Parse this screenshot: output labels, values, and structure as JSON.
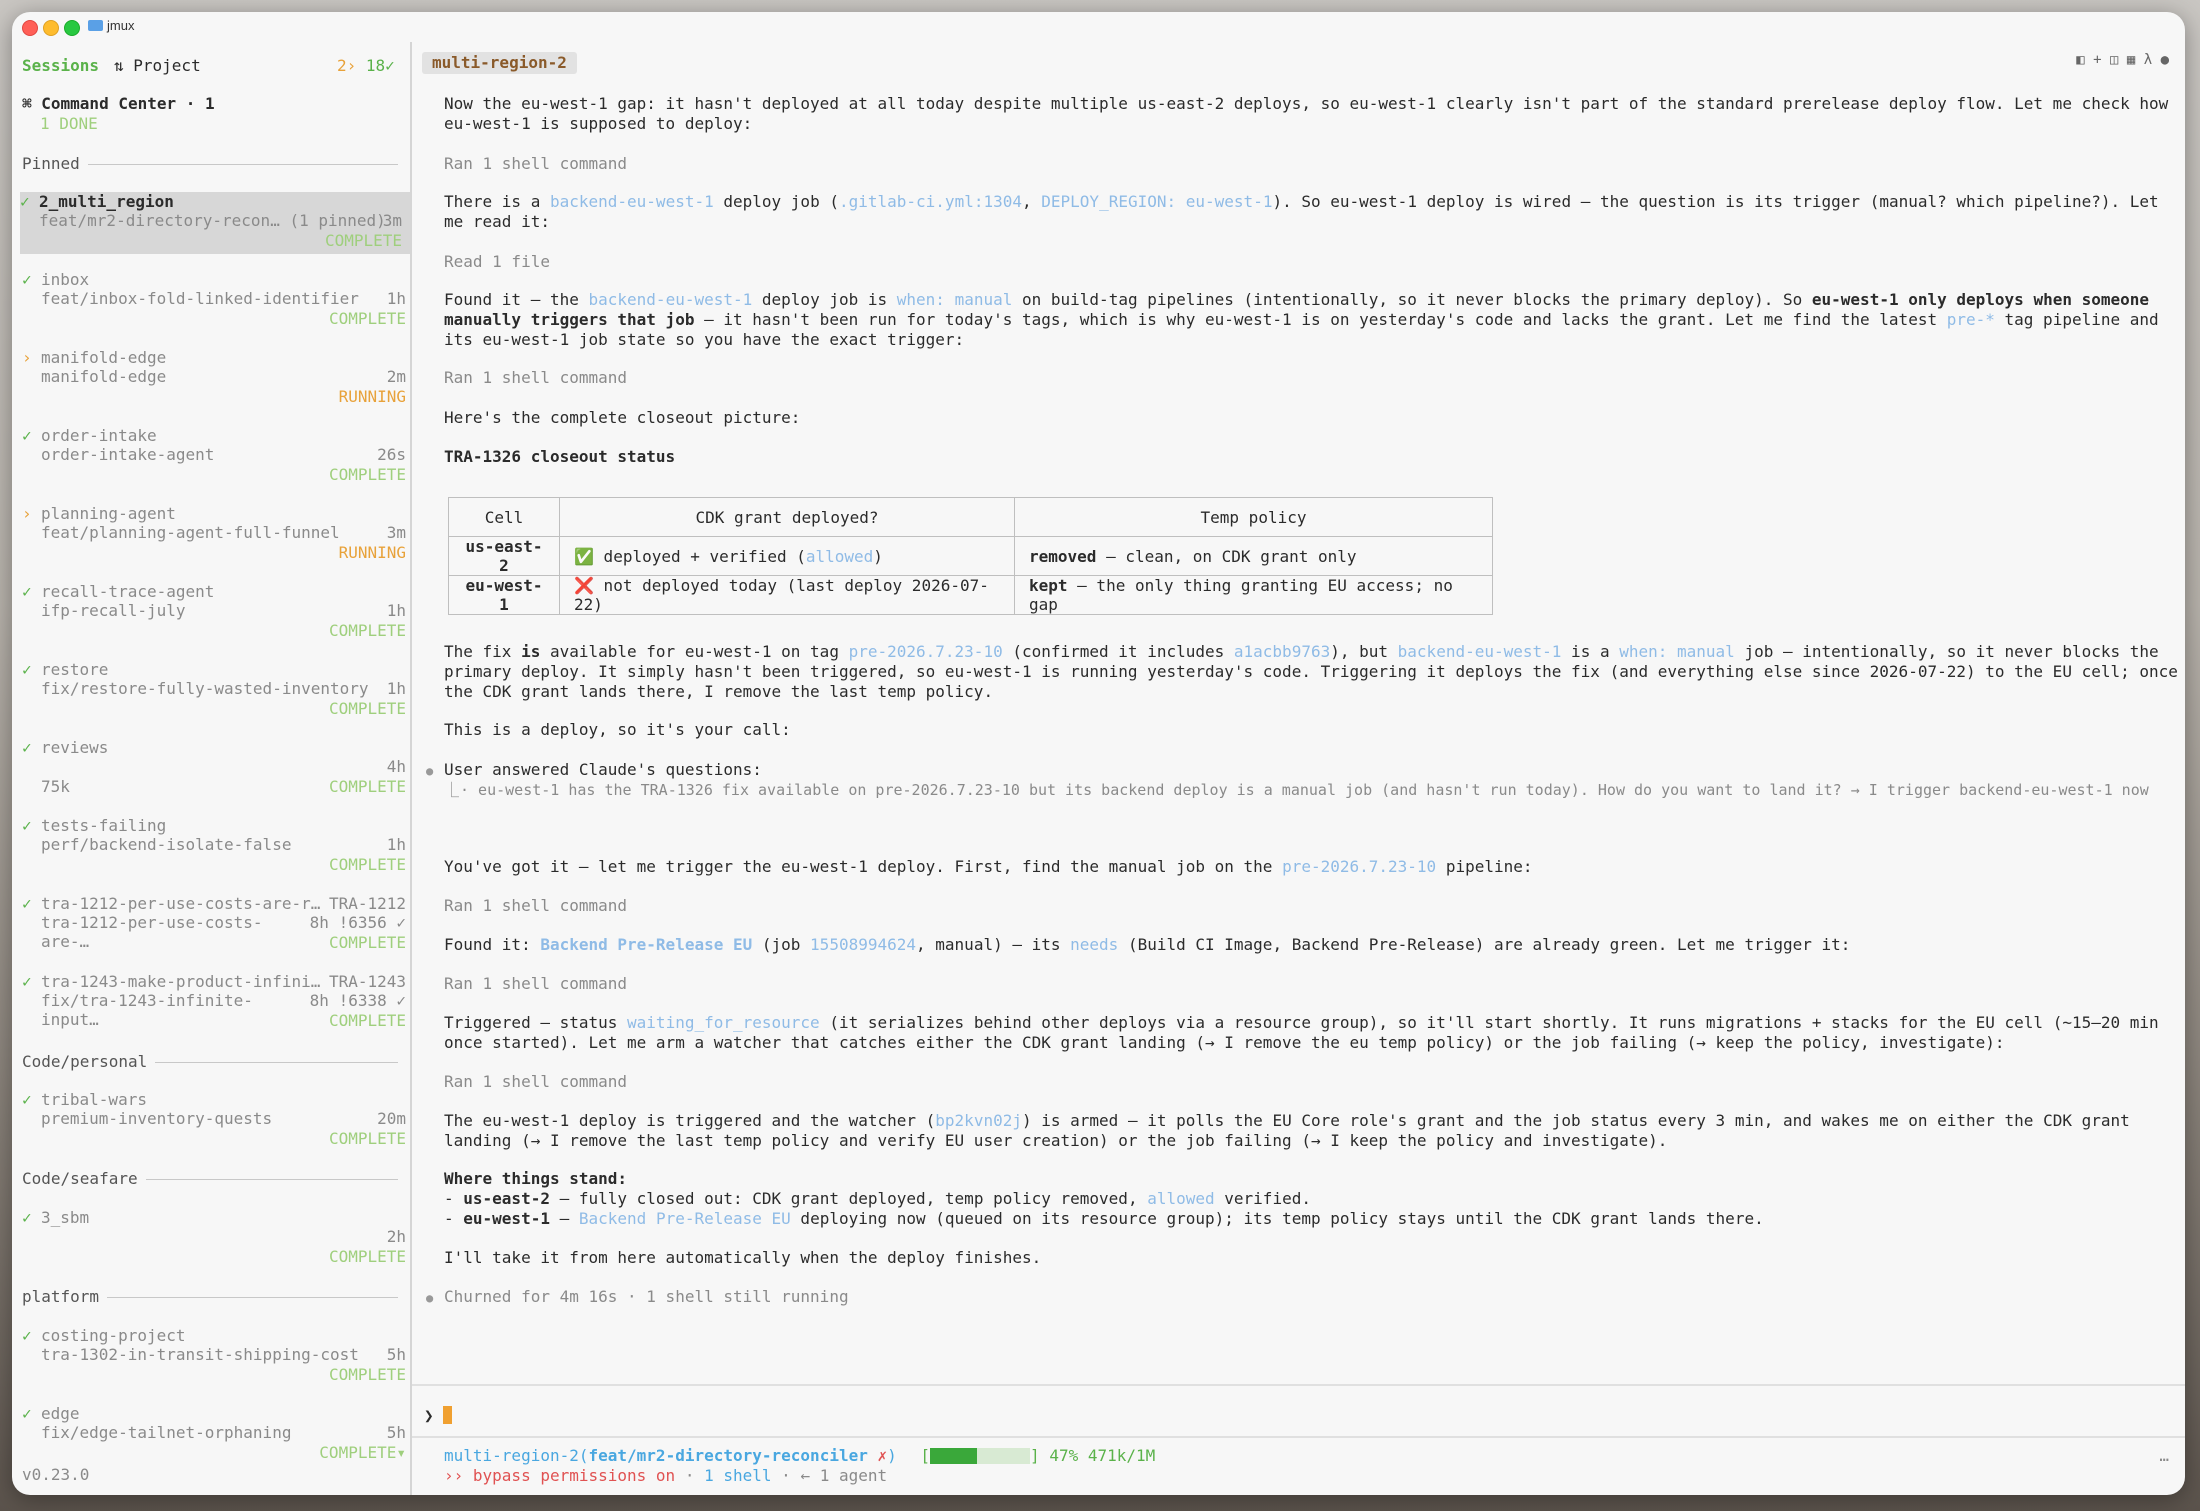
{
  "window": {
    "title": "jmux"
  },
  "sidebar": {
    "tab_sessions": "Sessions",
    "tab_project": "⇅ Project",
    "counts_running": "2›",
    "counts_done": "18✓",
    "command_center": "⌘ Command Center · 1",
    "command_center_status": "1 DONE",
    "version": "v0.23.0",
    "sections": {
      "pinned": "Pinned",
      "personal": "Code/personal",
      "seafare": "Code/seafare",
      "platform": "platform"
    },
    "sessions": [
      {
        "mark": "✓",
        "name": "2_multi_region",
        "sub": "feat/mr2-directory-recon… (1 pinned)",
        "age": "3m",
        "status": "COMPLETE"
      },
      {
        "mark": "✓",
        "name": "inbox",
        "sub": "feat/inbox-fold-linked-identifier",
        "age": "1h",
        "status": "COMPLETE"
      },
      {
        "mark": "›",
        "name": "manifold-edge",
        "sub": "manifold-edge",
        "age": "2m",
        "status": "RUNNING"
      },
      {
        "mark": "✓",
        "name": "order-intake",
        "sub": "order-intake-agent",
        "age": "26s",
        "status": "COMPLETE"
      },
      {
        "mark": "›",
        "name": "planning-agent",
        "sub": "feat/planning-agent-full-funnel",
        "age": "3m",
        "status": "RUNNING"
      },
      {
        "mark": "✓",
        "name": "recall-trace-agent",
        "sub": "ifp-recall-july",
        "age": "1h",
        "status": "COMPLETE"
      },
      {
        "mark": "✓",
        "name": "restore",
        "sub": "fix/restore-fully-wasted-inventory",
        "age": "1h",
        "status": "COMPLETE"
      },
      {
        "mark": "✓",
        "name": "reviews",
        "sub": "75k",
        "age": "4h",
        "status": "COMPLETE"
      },
      {
        "mark": "✓",
        "name": "tests-failing",
        "sub": "perf/backend-isolate-false",
        "age": "1h",
        "status": "COMPLETE"
      },
      {
        "mark": "✓",
        "name": "tra-1212-per-use-costs-are-r…",
        "extra": "TRA-1212",
        "sub": "tra-1212-per-use-costs-are-…",
        "age": "8h !6356 ✓",
        "status": "COMPLETE"
      },
      {
        "mark": "✓",
        "name": "tra-1243-make-product-infini…",
        "extra": "TRA-1243",
        "sub": "fix/tra-1243-infinite-input…",
        "age": "8h !6338 ✓",
        "status": "COMPLETE"
      },
      {
        "mark": "✓",
        "name": "tribal-wars",
        "sub": "premium-inventory-quests",
        "age": "20m",
        "status": "COMPLETE"
      },
      {
        "mark": "✓",
        "name": "3_sbm",
        "sub": "",
        "age": "2h",
        "status": "COMPLETE"
      },
      {
        "mark": "✓",
        "name": "costing-project",
        "sub": "tra-1302-in-transit-shipping-cost",
        "age": "5h",
        "status": "COMPLETE"
      },
      {
        "mark": "✓",
        "name": "edge",
        "sub": "fix/edge-tailnet-orphaning",
        "age": "5h",
        "status": "COMPLETE▾"
      }
    ]
  },
  "main": {
    "tab": "multi-region-2",
    "toolbar_icons": "◧ + ◫ ▦ λ ●",
    "ran_shell": "Ran 1 shell command",
    "read_file": "Read 1 file",
    "p1": "Now the eu-west-1 gap: it hasn't deployed at all today despite multiple us-east-2 deploys, so eu-west-1 clearly isn't part of the standard prerelease deploy flow. Let me check how eu-west-1 is supposed to deploy:",
    "p2": {
      "a": "There is a ",
      "job": "backend-eu-west-1",
      "b": " deploy job (",
      "file": ".gitlab-ci.yml:1304",
      "c": ", ",
      "env": "DEPLOY_REGION: eu-west-1",
      "d": "). So eu-west-1 deploy is wired — the question is its trigger (manual? which pipeline?). Let me read it:"
    },
    "p3": {
      "a": "Found it — the ",
      "job": "backend-eu-west-1",
      "b": " deploy job is ",
      "when": "when: manual",
      "c": " on build-tag pipelines (intentionally, so it never blocks the primary deploy). So ",
      "strong": "eu-west-1 only deploys when someone manually triggers that job",
      "d": " — it hasn't been run for today's tags, which is why eu-west-1 is on yesterday's code and lacks the grant. Let me find the latest ",
      "tag": "pre-*",
      "e": " tag pipeline and its eu-west-1 job state so you have the exact trigger:"
    },
    "p4": "Here's the complete closeout picture:",
    "heading": "TRA-1326 closeout status",
    "table": {
      "headers": [
        "Cell",
        "CDK grant deployed?",
        "Temp policy"
      ],
      "rows": [
        {
          "cell": "us-east-2",
          "icon": "✅",
          "grant_a": " deployed + verified (",
          "grant_link": "allowed",
          "grant_b": ")",
          "policy_strong": "removed",
          "policy_rest": " — clean, on CDK grant only"
        },
        {
          "cell": "eu-west-1",
          "icon": "❌",
          "grant_a": " not deployed today (last deploy 2026-07-22)",
          "grant_link": "",
          "grant_b": "",
          "policy_strong": "kept",
          "policy_rest": " — the only thing granting EU access; no gap"
        }
      ]
    },
    "p5": {
      "a": "The fix ",
      "is": "is",
      "b": " available for eu-west-1 on tag ",
      "tag": "pre-2026.7.23-10",
      "c": " (confirmed it includes ",
      "sha": "a1acbb9763",
      "d": "), but ",
      "job": "backend-eu-west-1",
      "e": " is a ",
      "when": "when: manual",
      "f": " job — intentionally, so it never blocks the primary deploy. It simply hasn't been triggered, so eu-west-1 is running yesterday's code. Triggering it deploys the fix (and everything else since 2026-07-22) to the EU cell; once the CDK grant lands there, I remove the last temp policy."
    },
    "p6": "This is a deploy, so it's your call:",
    "qa_title": "User answered Claude's questions:",
    "qa_body": "· eu-west-1 has the TRA-1326 fix available on pre-2026.7.23-10 but its backend deploy is a manual job (and hasn't run today). How do you want to land it? → I trigger backend-eu-west-1 now",
    "p7": {
      "a": "You've got it — let me trigger the eu-west-1 deploy. First, find the manual job on the ",
      "tag": "pre-2026.7.23-10",
      "b": " pipeline:"
    },
    "p8": {
      "a": "Found it: ",
      "job": "Backend Pre-Release EU",
      "b": " (job ",
      "id": "15508994624",
      "c": ", manual) — its ",
      "needs": "needs",
      "d": " (Build CI Image, Backend Pre-Release) are already green. Let me trigger it:"
    },
    "p9": {
      "a": "Triggered — status ",
      "status": "waiting_for_resource",
      "b": " (it serializes behind other deploys via a resource group), so it'll start shortly. It runs migrations + stacks for the EU cell (~15–20 min once started). Let me arm a watcher that catches either the CDK grant landing (→ I remove the eu temp policy) or the job failing (→ keep the policy, investigate):"
    },
    "p10": {
      "a": "The eu-west-1 deploy is triggered and the watcher (",
      "id": "bp2kvn02j",
      "b": ") is armed — it polls the EU Core role's grant and the job status every 3 min, and wakes me on either the CDK grant landing (→ I remove the last temp policy and verify EU user creation) or the job failing (→ I keep the policy and investigate)."
    },
    "stand_title": "Where things stand:",
    "stand1": {
      "a": "- ",
      "b": "us-east-2",
      "c": " — fully closed out: CDK grant deployed, temp policy removed, ",
      "link": "allowed",
      "d": " verified."
    },
    "stand2": {
      "a": "- ",
      "b": "eu-west-1",
      "c": " — ",
      "link": "Backend Pre-Release EU",
      "d": " deploying now (queued on its resource group); its temp policy stays until the CDK grant lands there."
    },
    "p11": "I'll take it from here automatically when the deploy finishes.",
    "churn": "Churned for 4m 16s · 1 shell still running",
    "prompt_glyph": "❯",
    "status": {
      "repo": "multi-region-2",
      "branch_open": "(",
      "branch": "feat/mr2-directory-reconciler",
      "dirty": " ✗",
      "branch_close": ")",
      "bar_open": "[",
      "bar_close": "]",
      "context_percent": 47,
      "context_pct_text": "47%",
      "context_tokens": "471k/1M",
      "bypass": "›› bypass permissions on",
      "shell": "1 shell",
      "agent": "· ← 1 agent",
      "sep": " · ",
      "ellipsis": "…"
    }
  },
  "colors": {
    "accent": "#5ab24a",
    "running": "#e8a23a",
    "link": "#8fbbe6",
    "branch": "#49a7e0"
  }
}
